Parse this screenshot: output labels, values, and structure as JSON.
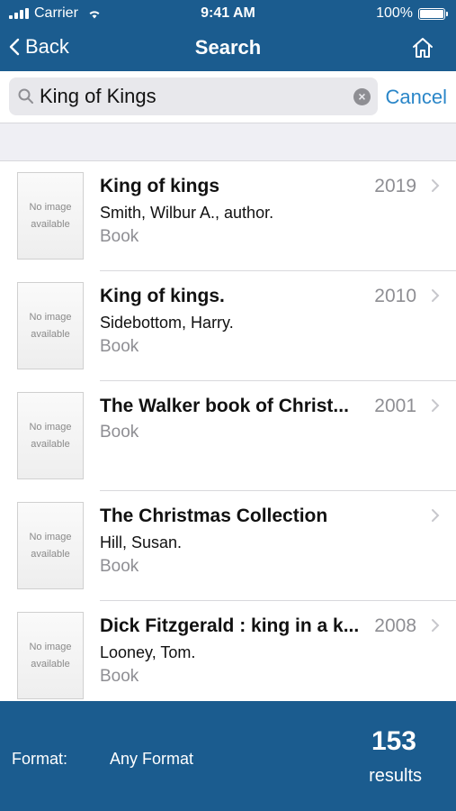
{
  "status_bar": {
    "carrier": "Carrier",
    "time": "9:41 AM",
    "battery": "100%"
  },
  "nav": {
    "back_label": "Back",
    "title": "Search"
  },
  "search": {
    "value": "King of Kings",
    "cancel_label": "Cancel"
  },
  "results": [
    {
      "title": "King of kings",
      "year": "2019",
      "author": "Smith, Wilbur A., author.",
      "format": "Book",
      "thumb_line1": "No image",
      "thumb_line2": "available"
    },
    {
      "title": "King of kings.",
      "year": "2010",
      "author": "Sidebottom, Harry.",
      "format": "Book",
      "thumb_line1": "No image",
      "thumb_line2": "available"
    },
    {
      "title": "The Walker book of Christ...",
      "year": "2001",
      "author": "",
      "format": "Book",
      "thumb_line1": "No image",
      "thumb_line2": "available"
    },
    {
      "title": "The Christmas Collection",
      "year": "",
      "author": "Hill, Susan.",
      "format": "Book",
      "thumb_line1": "No image",
      "thumb_line2": "available"
    },
    {
      "title": "Dick Fitzgerald : king in a k...",
      "year": "2008",
      "author": "Looney, Tom.",
      "format": "Book",
      "thumb_line1": "No image",
      "thumb_line2": "available"
    }
  ],
  "footer": {
    "format_label": "Format:",
    "format_value": "Any Format",
    "count": "153",
    "count_label": "results"
  },
  "colors": {
    "bar": "#1b5c8f",
    "accent": "#2a86c8",
    "secondary_text": "#8e8e93"
  }
}
